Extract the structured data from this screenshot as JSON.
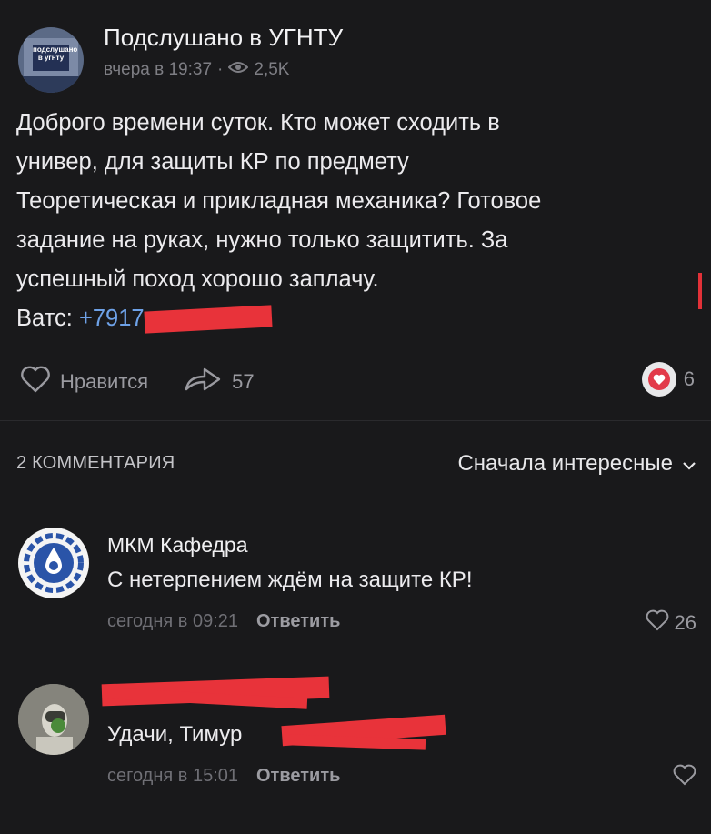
{
  "post": {
    "group_name": "Подслушано в УГНТУ",
    "avatar_text": "подслушано в угнту",
    "time": "вчера в 19:37",
    "separator": "·",
    "views": "2,5K",
    "text_lines": [
      "Доброго времени суток. Кто может сходить в",
      "универ, для защиты КР по предмету",
      "Теоретическая и прикладная механика? Готовое",
      "задание на руках, нужно только защитить. За",
      "успешный поход хорошо заплачу."
    ],
    "contact_label": "Ватс: ",
    "contact_phone": "+7917",
    "like_label": "Нравится",
    "shares": "57",
    "reactions": "6"
  },
  "comments": {
    "count_label": "2 КОММЕНТАРИЯ",
    "sort_label": "Сначала интересные",
    "items": [
      {
        "name": "МКМ Кафедра",
        "text": "С нетерпением ждём на защите КР!",
        "time": "сегодня в 09:21",
        "reply": "Ответить",
        "likes": "26"
      },
      {
        "name": "",
        "text": "Удачи, Тимур",
        "time": "сегодня в 15:01",
        "reply": "Ответить",
        "likes": ""
      }
    ]
  },
  "colors": {
    "background": "#19191b",
    "link": "#6ea2e8",
    "redaction": "#e8333a",
    "heart": "#e23a4a"
  }
}
